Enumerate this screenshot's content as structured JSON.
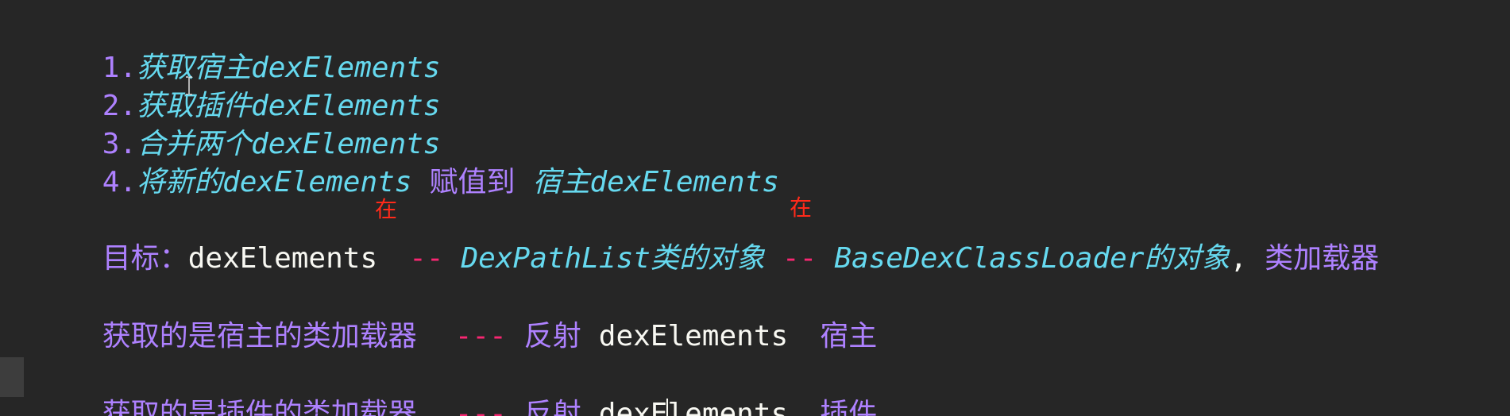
{
  "steps": [
    {
      "num": "1.",
      "text": "获取宿主dexElements"
    },
    {
      "num": "2.",
      "text": "获取插件dexElements"
    },
    {
      "num": "3.",
      "text": "合并两个dexElements"
    },
    {
      "num": "4.",
      "part1": "将新的dexElements",
      "part2": "赋值到",
      "part3": "宿主dexElements"
    }
  ],
  "goal": {
    "label": "目标：",
    "target": "dexElements",
    "dash1": "--",
    "marker1": "在",
    "class_obj": "DexPathList类的对象",
    "dash2": "--",
    "marker2": "在",
    "loader_obj": "BaseDexClassLoader的对象",
    "comma": ",",
    "suffix": "类加载器"
  },
  "host_line": {
    "label": "获取的是宿主的类加载器",
    "dashes": "---",
    "verb": "反射",
    "field": "dexElements",
    "target": "宿主"
  },
  "plugin_line": {
    "label": "获取的是插件的类加载器",
    "dashes": "---",
    "verb": "反射",
    "field_a": "dexE",
    "field_b": "lements",
    "target": "插件"
  },
  "colors": {
    "background": "#262626",
    "purple": "#ae81ff",
    "cyan_italic": "#66d9ef",
    "red": "#f92672",
    "annotation": "#ff2a1a"
  }
}
